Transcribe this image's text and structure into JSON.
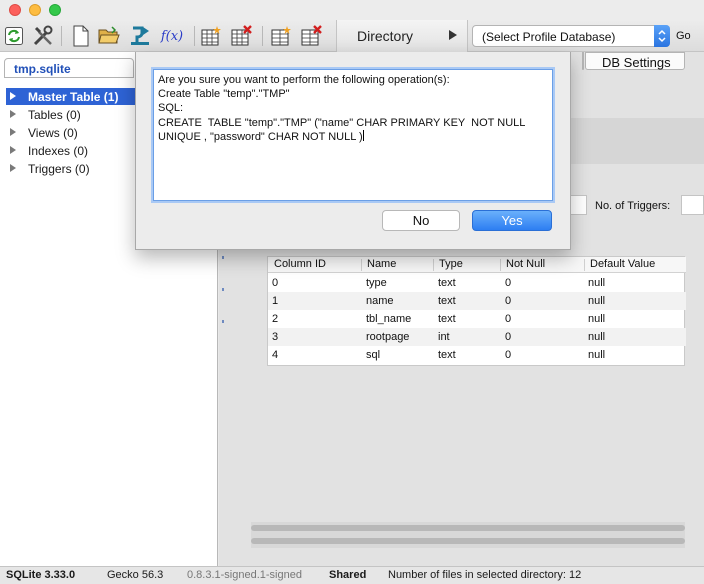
{
  "toolbar": {
    "directory_label": "Directory",
    "profile_select": "(Select Profile Database)",
    "go_label": "Go",
    "fx_label": "f(x)"
  },
  "left_panel": {
    "db_tab": "tmp.sqlite",
    "tree": [
      {
        "label": "Master Table (1)",
        "selected": true
      },
      {
        "label": "Tables (0)",
        "selected": false
      },
      {
        "label": "Views (0)",
        "selected": false
      },
      {
        "label": "Indexes (0)",
        "selected": false
      },
      {
        "label": "Triggers (0)",
        "selected": false
      }
    ]
  },
  "right_panel": {
    "tab_db_settings": "DB Settings",
    "no_of_triggers": "No. of Triggers:",
    "columns_table": {
      "headers": [
        "Column ID",
        "Name",
        "Type",
        "Not Null",
        "Default Value"
      ],
      "rows": [
        [
          "0",
          "type",
          "text",
          "0",
          "null"
        ],
        [
          "1",
          "name",
          "text",
          "0",
          "null"
        ],
        [
          "2",
          "tbl_name",
          "text",
          "0",
          "null"
        ],
        [
          "3",
          "rootpage",
          "int",
          "0",
          "null"
        ],
        [
          "4",
          "sql",
          "text",
          "0",
          "null"
        ]
      ]
    }
  },
  "dialog": {
    "lines": [
      "Are you sure you want to perform the following operation(s):",
      "Create Table \"temp\".\"TMP\"",
      "SQL:",
      "CREATE  TABLE \"temp\".\"TMP\" (\"name\" CHAR PRIMARY KEY  NOT NULL",
      "UNIQUE , \"password\" CHAR NOT NULL )"
    ],
    "no_label": "No",
    "yes_label": "Yes"
  },
  "statusbar": {
    "sqlite_version": "SQLite 3.33.0",
    "gecko_version": "Gecko 56.3",
    "build": "0.8.3.1-signed.1-signed",
    "shared": "Shared",
    "file_count": "Number of files in selected directory: 12"
  }
}
